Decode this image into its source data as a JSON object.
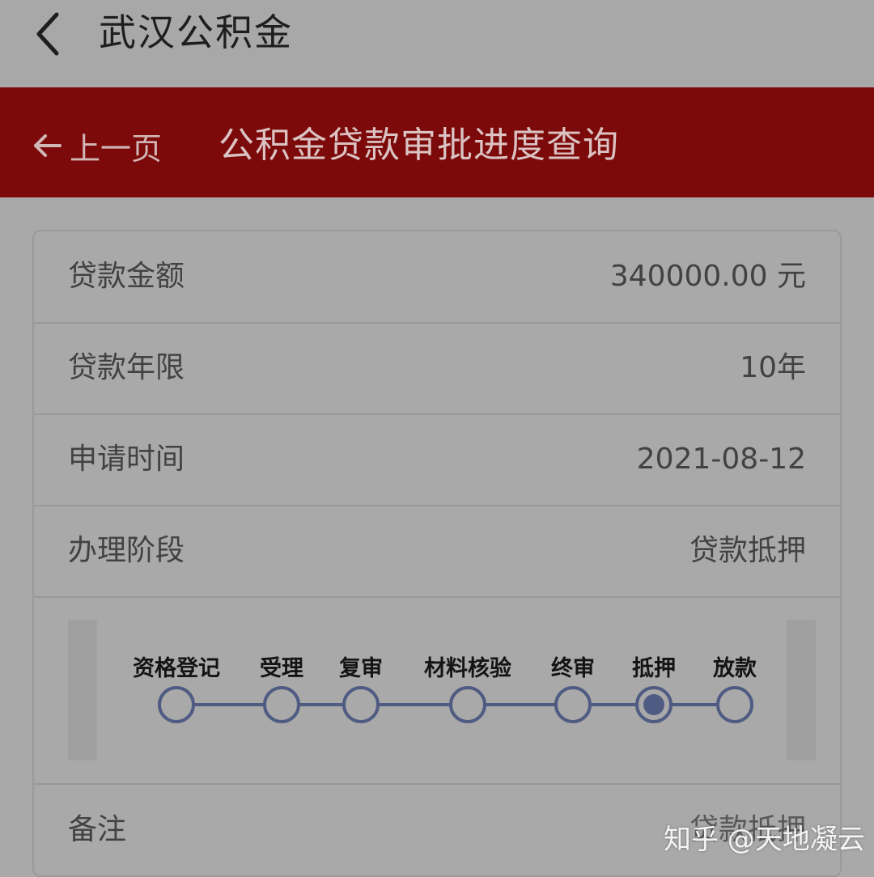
{
  "appbar": {
    "title": "武汉公积金",
    "back_icon": "chevron-left-icon"
  },
  "banner": {
    "prev_label": "上一页",
    "prev_icon": "arrow-left-icon",
    "title": "公积金贷款审批进度查询",
    "color": "#7c0a0a"
  },
  "details": [
    {
      "label": "贷款金额",
      "value": "340000.00 元"
    },
    {
      "label": "贷款年限",
      "value": "10年"
    },
    {
      "label": "申请时间",
      "value": "2021-08-12"
    },
    {
      "label": "办理阶段",
      "value": "贷款抵押"
    }
  ],
  "progress": {
    "steps": [
      "资格登记",
      "受理",
      "复审",
      "材料核验",
      "终审",
      "抵押",
      "放款"
    ],
    "current_index": 5,
    "color": "#4f5b82"
  },
  "remark": {
    "label": "备注",
    "value": "贷款抵押"
  },
  "watermark": "知乎 @天地凝云"
}
